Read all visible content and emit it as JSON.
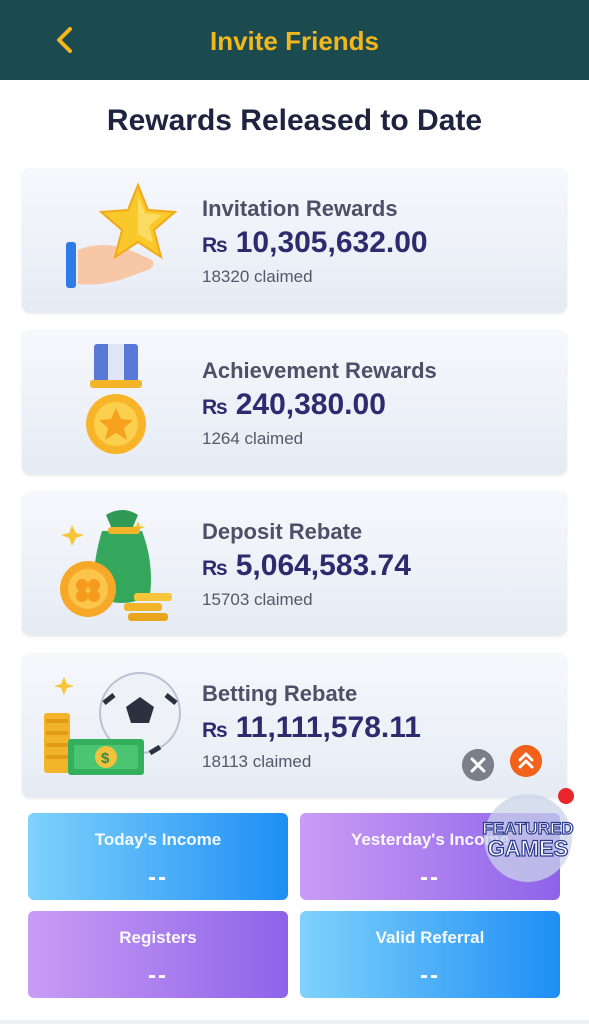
{
  "header": {
    "title": "Invite Friends"
  },
  "section_title": "Rewards Released to Date",
  "currency": "₨",
  "rewards": [
    {
      "label": "Invitation Rewards",
      "amount": "10,305,632.00",
      "claimed": "18320 claimed",
      "icon": "star-hand-icon"
    },
    {
      "label": "Achievement Rewards",
      "amount": "240,380.00",
      "claimed": "1264 claimed",
      "icon": "medal-icon"
    },
    {
      "label": "Deposit Rebate",
      "amount": "5,064,583.74",
      "claimed": "15703 claimed",
      "icon": "money-bag-icon"
    },
    {
      "label": "Betting Rebate",
      "amount": "11,111,578.11",
      "claimed": "18113 claimed",
      "icon": "football-cash-icon"
    }
  ],
  "stats": [
    {
      "title": "Today's Income",
      "value": "--"
    },
    {
      "title": "Yesterday's Income",
      "value": "--"
    },
    {
      "title": "Registers",
      "value": "--"
    },
    {
      "title": "Valid Referral",
      "value": "--"
    }
  ],
  "floating": {
    "badge_line1": "FEATURED",
    "badge_line2": "GAMES"
  },
  "colors": {
    "header_bg": "#1c4b4f",
    "header_text": "#f3b71e",
    "amount": "#2b2b6e",
    "scroll_top": "#f3621a"
  }
}
